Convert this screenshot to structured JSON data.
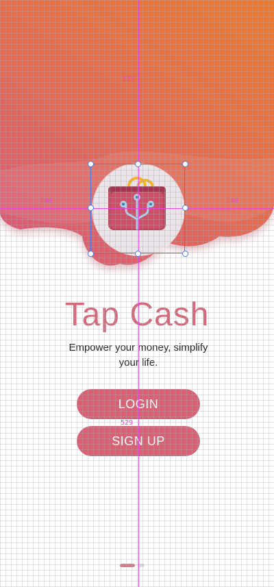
{
  "app": {
    "title": "Tap Cash",
    "tagline": "Empower your money, simplify your life."
  },
  "buttons": {
    "login": "LOGIN",
    "signup": "SIGN UP"
  },
  "icons": {
    "logo": "wallet-circuit-icon"
  },
  "colors": {
    "accent": "#dc5f74",
    "title": "#d9677a",
    "hero_top": "#f0782a",
    "hero_bottom": "#e15a72"
  },
  "pager": {
    "pages": 2,
    "active": 1
  },
  "design_overlay": {
    "measure_top": "227",
    "measure_left": "148",
    "measure_right": "148",
    "measure_buttons": "529"
  }
}
